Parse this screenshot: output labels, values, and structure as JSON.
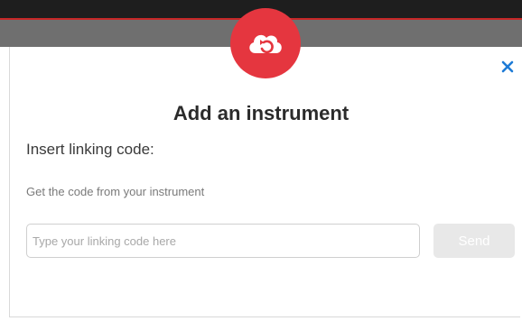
{
  "modal": {
    "title": "Add an instrument",
    "subtitle": "Insert linking code:",
    "hint": "Get the code from your instrument",
    "close_icon": "close-icon",
    "logo_icon": "cloud-sync-icon"
  },
  "form": {
    "code_placeholder": "Type your linking code here",
    "code_value": "",
    "send_label": "Send"
  },
  "colors": {
    "brand_red": "#e5363f",
    "close_blue": "#1e7bd6",
    "send_disabled_bg": "#e8e8e8"
  }
}
